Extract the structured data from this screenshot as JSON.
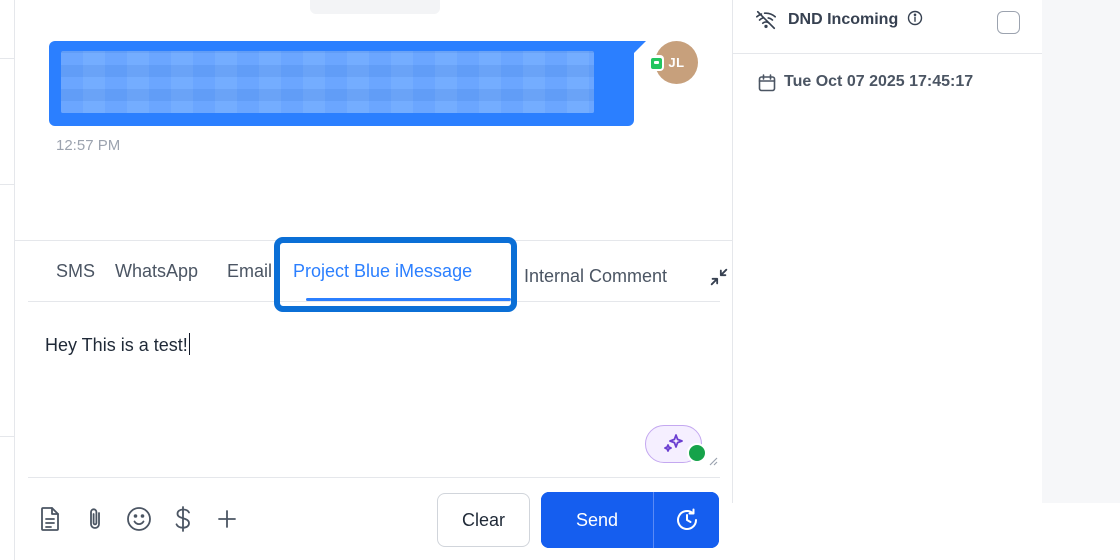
{
  "conversation": {
    "avatar_initials": "JL",
    "message_time": "12:57 PM"
  },
  "composer": {
    "tabs": [
      {
        "label": "SMS",
        "active": false
      },
      {
        "label": "WhatsApp",
        "active": false
      },
      {
        "label": "Email",
        "active": false
      },
      {
        "label": "Project Blue iMessage",
        "active": true
      },
      {
        "label": "Internal Comment",
        "active": false
      }
    ],
    "message_text": "Hey This is a test!",
    "clear_label": "Clear",
    "send_label": "Send"
  },
  "right_panel": {
    "dnd_label": "DND Incoming",
    "dnd_checked": false,
    "date_text": "Tue Oct 07 2025 17:45:17"
  },
  "colors": {
    "accent": "#2b7fff",
    "send_button": "#155eef",
    "highlight": "#0b6fd6"
  },
  "icons": {
    "toolbar": [
      "document-icon",
      "paperclip-icon",
      "emoji-icon",
      "dollar-icon",
      "plus-icon"
    ],
    "other": [
      "collapse-icon",
      "sparkles-icon",
      "schedule-icon",
      "wifi-off-icon",
      "info-icon",
      "calendar-icon"
    ]
  }
}
